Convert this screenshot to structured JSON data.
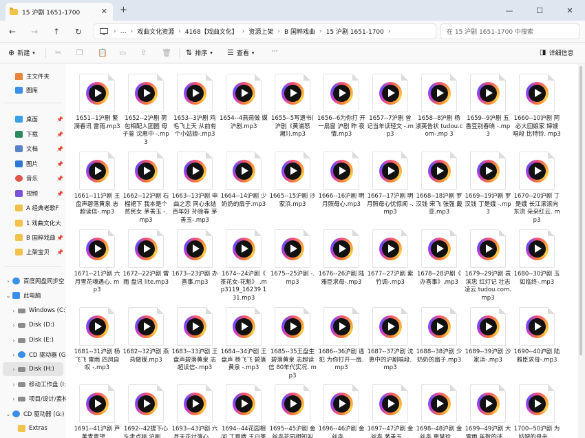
{
  "window": {
    "tab_title": "15 沪剧 1651-1700",
    "new_tab_symbol": "+",
    "close_symbol": "✕",
    "minimize_symbol": "—",
    "maximize_symbol": "☐"
  },
  "nav": {
    "back_symbol": "←",
    "forward_symbol": "→",
    "up_symbol": "↑",
    "refresh_symbol": "↻",
    "breadcrumbs": [
      "戏曲文化资源",
      "4168【戏曲文化】",
      "资源上架",
      "B 国粹戏曲",
      "15 沪剧 1651-1700"
    ],
    "search_placeholder": "在 15 沪剧 1651-1700 中搜索"
  },
  "toolbar": {
    "new_label": "新建",
    "sort_label": "排序",
    "view_label": "查看",
    "more_label": "···",
    "details_label": "详细信息"
  },
  "sidebar": {
    "quick": [
      {
        "label": "主文件夹",
        "icon": "home-icon"
      },
      {
        "label": "图库",
        "icon": "gallery-icon"
      }
    ],
    "pinned": [
      {
        "label": "桌面",
        "icon": "desktop-icon"
      },
      {
        "label": "下载",
        "icon": "download-icon"
      },
      {
        "label": "文档",
        "icon": "documents-icon"
      },
      {
        "label": "图片",
        "icon": "pictures-icon"
      },
      {
        "label": "音乐",
        "icon": "music-icon"
      },
      {
        "label": "视频",
        "icon": "videos-icon"
      },
      {
        "label": "A 经典老歌F",
        "icon": "folder-icon"
      },
      {
        "label": "1 戏曲文化大",
        "icon": "folder-icon"
      },
      {
        "label": "B 国粹戏曲",
        "icon": "folder-icon"
      },
      {
        "label": "上架宝贝",
        "icon": "folder-icon"
      }
    ],
    "tree": [
      {
        "label": "百度网盘同步空",
        "icon": "cloud-icon"
      },
      {
        "label": "此电脑",
        "icon": "pc-icon"
      },
      {
        "label": "Windows (C:)",
        "icon": "drive-icon"
      },
      {
        "label": "Disk (D:)",
        "icon": "drive-icon"
      },
      {
        "label": "Disk (E:)",
        "icon": "drive-icon"
      },
      {
        "label": "CD 驱动器 (G:",
        "icon": "cd-icon"
      },
      {
        "label": "Disk (H:)",
        "icon": "drive-icon"
      },
      {
        "label": "移动工作盘 (I:",
        "icon": "drive-icon"
      },
      {
        "label": "项目/设计/素材",
        "icon": "drive-icon"
      },
      {
        "label": "CD 驱动器 (G:)",
        "icon": "cd-icon"
      },
      {
        "label": "Extras",
        "icon": "folder-icon"
      }
    ]
  },
  "files": [
    "1651--1沪剧 繁 漪春讯 雷雨.mp3",
    "1652--2沪剧 荷 包相配人团圆 母 子鉴 沈惠中 -.mp3",
    "1653--3沪剧 鸡 毛飞上天 从前有 个小姑娘-.mp3",
    "1654--4燕燕做 媒 沪剧.mp3",
    "1655--5写遗书( 沪剧《黄浦怒 潮》).mp3",
    "1656--6为你打 开一扇窗 沪剧 昨 夜情.mp3",
    "1657--7沪剧 曾 记当年读轻文 -.mp3",
    "1658--8沪剧 杨 淑英告状 tudou.com-.mp 3",
    "1659--9沪剧 五 香豆别春晓 -.mp3",
    "1660--10沪剧 阿 必大回娘家 婶嫂 唱段 比特铃. mp3",
    "1661--11沪剧 王 盘声碧落黄泉 志 超读信-.mp3",
    "1662--12沪剧 石 榴裙下 我本是个 贫民女 茅善玉 -.mp3",
    "1663--13沪剧 申 曲之恋 同心永结 百年好 孙徐春 茅 善玉-.mp3",
    "1664--14沪剧 少 奶奶的扇子.mp3",
    "1665--15沪剧 沙 家浜.mp3",
    "1666--16沪剧 明 月照母心.mp3",
    "1667--17沪剧 明 月照母心忧惊闻 -.mp3",
    "1668--18沪剧 罗 汉钱 宋飞 张强 戴亚.mp3",
    "1669--19沪剧 罗 汉钱 丁是娥 -.mp3",
    "1670--20沪剧 丁 是娥 长江滚滚向 东流 朵朵红云. mp3",
    "1671--21沪剧 六 月雪花魂遇心. mp3",
    "1672--22沪剧 雷 雨 盘讯 lite.mp3",
    "1673--23沪剧 办 喜事.mp3",
    "1674--24沪剧《 茶花女-花魁》 .mp3119_16239 131.mp3",
    "1675--25沪剧 -.mp3",
    "1676--26沪剧 陆 雅臣求母-.mp3",
    "1677--27沪剧 紫 竹调-.mp3",
    "1678--28沪剧《 办喜事》.mp3",
    "1679--29沪剧 袁 滨忠 红灯记 壮志 凌云 tudou.com.mp3",
    "1680--30沪剧 玉 如临终-.mp3",
    "1681--31沪剧 杨 飞飞 雷雨 四凤自 叹 -.mp3",
    "1682--32沪剧 燕 燕做媒.mp3",
    "1683--33沪剧 王 盘声碧落黄泉 志 超读信-.mp3",
    "1684--34沪剧 王 盘声 杨飞飞 碧落 黄泉 -.mp3",
    "1685--35王盘生 碧落黄泉 志超读 信 80年代实况. mp3",
    "1686--36沪剧 逃 犯 为你打开一扇. mp3",
    "1687--37沪剧 沈 惠中的沪剧唱段. mp3",
    "1688--38沪剧 少 奶奶的扇子.mp3",
    "1689--39沪剧 沙 家浜-.mp3",
    "1690--40沪剧 陆 雅臣求母-.mp3",
    "1691--41沪剧 芦 苇青青望 ...",
    "1692--42提下心 头走点啥 沪剧 ...",
    "1693--43沪剧 六 月天花计落心 ...",
    "1694--44花园相 问 丁是娥 王白英 ...",
    "1695--45沪剧 金 丝鸟花园相知叫 ...",
    "1696--46沪剧 金 丝鸟 ...",
    "1697--47沪剧 金 丝鸟 茅善玉 ...",
    "1698--48沪剧 金 丝鸟 惠慧玲 ...",
    "1699--49沪剧 大 雷雨 年数的逃 ...",
    "1700--50沪剧 为 姑嫂的母亲 ..."
  ]
}
